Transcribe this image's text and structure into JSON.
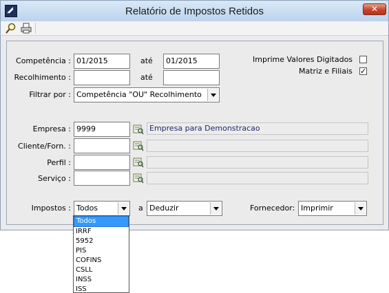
{
  "window": {
    "title": "Relatório de Impostos Retidos",
    "close_label": "✕"
  },
  "toolbar": {
    "icons": [
      "magnifier-icon",
      "printer-icon"
    ]
  },
  "form": {
    "competencia": {
      "label": "Competência :",
      "from": "01/2015",
      "ate_label": "até",
      "to": "01/2015"
    },
    "recolhimento": {
      "label": "Recolhimento :",
      "from": "",
      "ate_label": "até",
      "to": ""
    },
    "filtrar": {
      "label": "Filtrar por :",
      "value": "Competência \"OU\" Recolhimento"
    },
    "imprime_valores": {
      "label": "Imprime Valores Digitados",
      "checked": false
    },
    "matriz_filiais": {
      "label": "Matriz e Filiais",
      "checked": true,
      "mark": "✓"
    },
    "empresa": {
      "label": "Empresa :",
      "code": "9999",
      "name": "Empresa para Demonstracao"
    },
    "cliente": {
      "label": "Cliente/Forn. :",
      "code": "",
      "name": ""
    },
    "perfil": {
      "label": "Perfil :",
      "code": "",
      "name": ""
    },
    "servico": {
      "label": "Serviço :",
      "code": "",
      "name": ""
    },
    "impostos": {
      "label": "Impostos :",
      "value": "Todos"
    },
    "a_label": "a",
    "deduzir": {
      "value": "Deduzir"
    },
    "fornecedor": {
      "label": "Fornecedor:",
      "value": "Imprimir"
    }
  },
  "impostos_dropdown": {
    "options": [
      "Todos",
      "IRRF",
      "5952",
      "PIS",
      "COFINS",
      "CSLL",
      "INSS",
      "ISS"
    ],
    "selected": "Todos"
  },
  "colors": {
    "selection": "#3399ff",
    "readonly_text": "#1a2a6c",
    "close_button": "#c8432b"
  }
}
